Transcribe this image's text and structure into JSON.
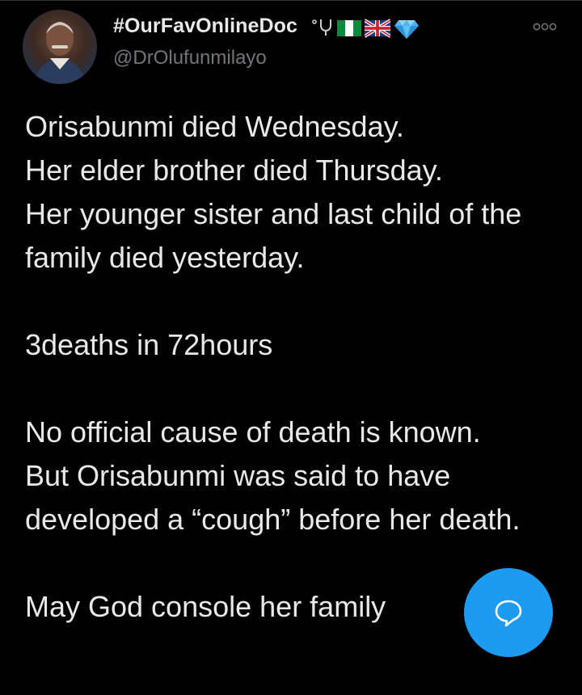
{
  "tweet": {
    "author": {
      "display_name": "#OurFavOnlineDoc",
      "handle": "@DrOlufunmilayo",
      "name_emojis": [
        "stethoscope-icon",
        "nigeria-flag-icon",
        "uk-flag-icon",
        "gem-icon"
      ]
    },
    "paragraphs": [
      "Orisabunmi died Wednesday.\nHer elder brother died Thursday.\nHer younger sister and last child of the family died yesterday.",
      "3deaths in 72hours",
      "No official cause of death is known.\nBut Orisabunmi was said to have developed a “cough” before her death.",
      "May God console her family"
    ]
  },
  "colors": {
    "background": "#000000",
    "text_primary": "#e7e9ea",
    "text_secondary": "#71767b",
    "accent": "#1d9bf0"
  },
  "actions": {
    "more_icon": "more-options-icon",
    "fab_icon": "reply-bubble-icon"
  }
}
